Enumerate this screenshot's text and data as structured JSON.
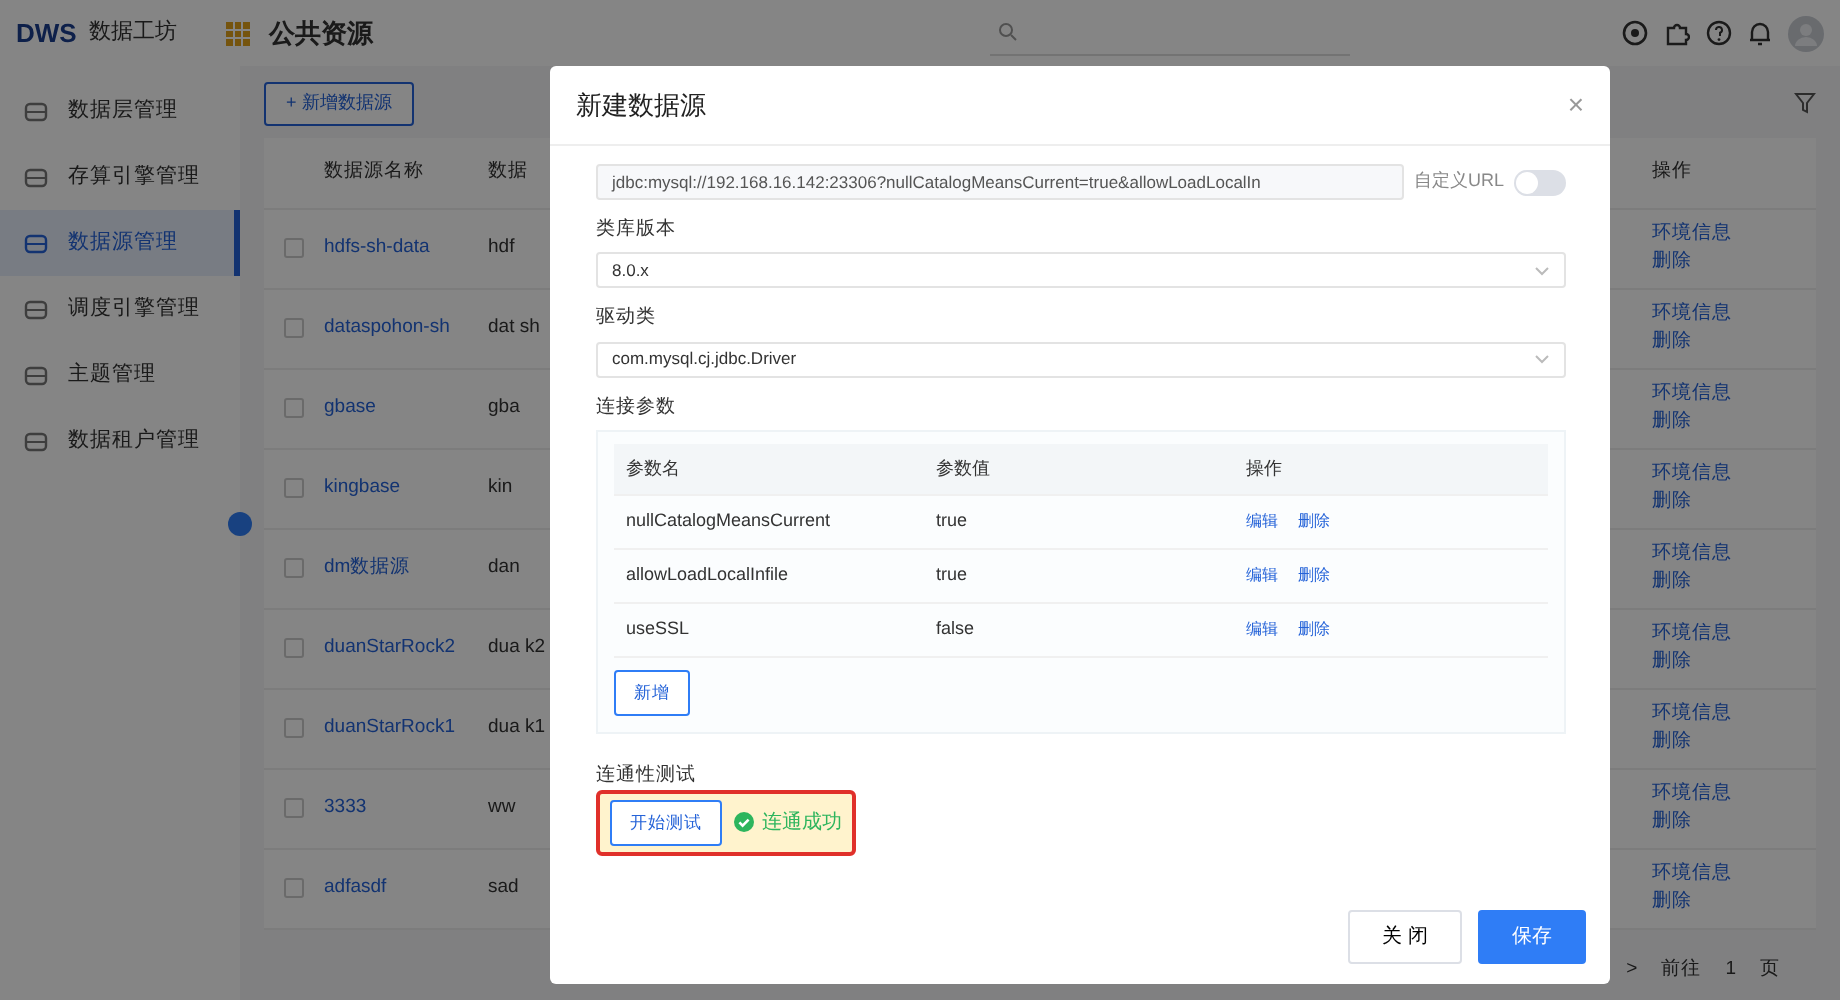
{
  "header": {
    "logo": "DWS",
    "app_name": "数据工坊",
    "section": "公共资源"
  },
  "sidebar": {
    "items": [
      {
        "label": "数据层管理",
        "selected": false
      },
      {
        "label": "存算引擎管理",
        "selected": false
      },
      {
        "label": "数据源管理",
        "selected": true
      },
      {
        "label": "调度引擎管理",
        "selected": false
      },
      {
        "label": "主题管理",
        "selected": false
      },
      {
        "label": "数据租户管理",
        "selected": false
      }
    ]
  },
  "toolbar": {
    "add_button": "+ 新增数据源"
  },
  "table": {
    "columns": [
      "数据源名称",
      "数据",
      "操作"
    ],
    "rows": [
      {
        "name": "hdfs-sh-data",
        "checked": false,
        "column_2": "hdf",
        "actions": [
          "环境信息",
          "删除"
        ]
      },
      {
        "name": "dataspohon-sh",
        "checked": false,
        "column_2": "dat sh",
        "actions": [
          "环境信息",
          "删除"
        ]
      },
      {
        "name": "gbase",
        "checked": false,
        "column_2": "gba",
        "actions": [
          "环境信息",
          "删除"
        ]
      },
      {
        "name": "kingbase",
        "checked": false,
        "column_2": "kin",
        "actions": [
          "环境信息",
          "删除"
        ]
      },
      {
        "name": "dm数据源",
        "checked": false,
        "column_2": "dan",
        "actions": [
          "环境信息",
          "删除"
        ]
      },
      {
        "name": "duanStarRock2",
        "checked": false,
        "column_2": "dua k2",
        "actions": [
          "环境信息",
          "删除"
        ]
      },
      {
        "name": "duanStarRock1",
        "checked": false,
        "column_2": "dua k1",
        "actions": [
          "环境信息",
          "删除"
        ]
      },
      {
        "name": "3333",
        "checked": false,
        "column_2": "ww",
        "actions": [
          "环境信息",
          "删除"
        ]
      },
      {
        "name": "adfasdf",
        "checked": false,
        "column_2": "sad",
        "actions": [
          "环境信息",
          "删除"
        ]
      }
    ]
  },
  "pagination": {
    "next": ">",
    "goto": "前往",
    "page": "1",
    "unit": "页"
  },
  "dialog": {
    "title": "新建数据源",
    "close": "×",
    "url": {
      "value": "jdbc:mysql://192.168.16.142:23306?nullCatalogMeansCurrent=true&allowLoadLocalIn",
      "custom_label": "自定义URL",
      "custom_on": false
    },
    "fields": [
      {
        "label": "类库版本",
        "value": "8.0.x"
      },
      {
        "label": "驱动类",
        "value": "com.mysql.cj.jdbc.Driver"
      }
    ],
    "params": {
      "label": "连接参数",
      "columns": [
        "参数名",
        "参数值",
        "操作"
      ],
      "rows": [
        {
          "name": "nullCatalogMeansCurrent",
          "value": "true",
          "actions": [
            "编辑",
            "删除"
          ]
        },
        {
          "name": "allowLoadLocalInfile",
          "value": "true",
          "actions": [
            "编辑",
            "删除"
          ]
        },
        {
          "name": "useSSL",
          "value": "false",
          "actions": [
            "编辑",
            "删除"
          ]
        }
      ],
      "add_button": "新增"
    },
    "test": {
      "label": "连通性测试",
      "button": "开始测试",
      "result": "连通成功",
      "success": true,
      "highlighted": true
    },
    "buttons": [
      "关 闭",
      "保存"
    ]
  }
}
